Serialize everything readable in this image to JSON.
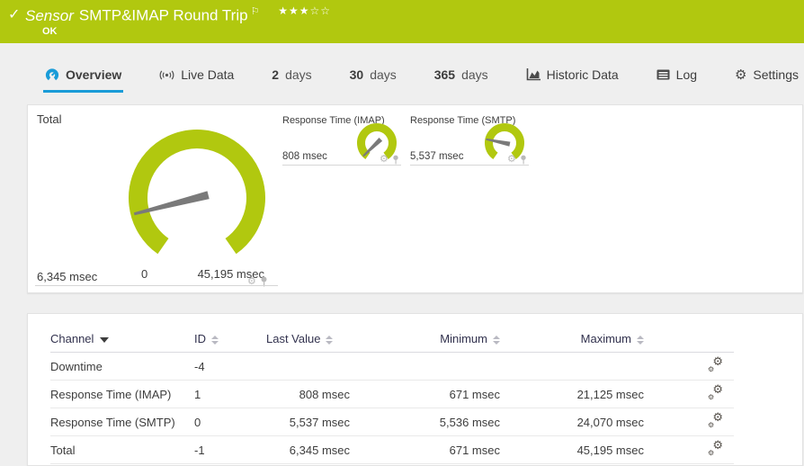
{
  "header": {
    "check": "✓",
    "kind": "Sensor",
    "title": "SMTP&IMAP Round Trip",
    "flag": "⚐",
    "stars_filled": "★★★",
    "stars_empty": "☆☆",
    "status": "OK"
  },
  "tabs": {
    "overview": {
      "label": "Overview"
    },
    "live": {
      "label": "Live Data"
    },
    "d2": {
      "num": "2",
      "unit": "days"
    },
    "d30": {
      "num": "30",
      "unit": "days"
    },
    "d365": {
      "num": "365",
      "unit": "days"
    },
    "historic": {
      "label": "Historic Data"
    },
    "log": {
      "label": "Log"
    },
    "settings": {
      "label": "Settings",
      "icon": "⚙"
    }
  },
  "gauges": {
    "total": {
      "title": "Total",
      "value": 6345,
      "max": 45195,
      "value_label": "6,345 msec",
      "scale_min": "0",
      "scale_max": "45,195 msec"
    },
    "imap": {
      "title": "Response Time (IMAP)",
      "value": 808,
      "max": 21125,
      "value_label": "808 msec"
    },
    "smtp": {
      "title": "Response Time (SMTP)",
      "value": 5537,
      "max": 24070,
      "value_label": "5,537 msec"
    }
  },
  "icons": {
    "mini_gear": "⚙",
    "channel_gear": "⚙"
  },
  "table": {
    "headers": {
      "channel": "Channel",
      "id": "ID",
      "last": "Last Value",
      "min": "Minimum",
      "max": "Maximum"
    },
    "rows": [
      {
        "channel": "Downtime",
        "id": "-4",
        "last": "",
        "min": "",
        "max": ""
      },
      {
        "channel": "Response Time (IMAP)",
        "id": "1",
        "last": "808 msec",
        "min": "671 msec",
        "max": "21,125 msec"
      },
      {
        "channel": "Response Time (SMTP)",
        "id": "0",
        "last": "5,537 msec",
        "min": "5,536 msec",
        "max": "24,070 msec"
      },
      {
        "channel": "Total",
        "id": "-1",
        "last": "6,345 msec",
        "min": "671 msec",
        "max": "45,195 msec"
      }
    ]
  },
  "colors": {
    "green": "#b1c80f",
    "blue": "#1a9cd8",
    "needle": "#7a7a7a"
  }
}
